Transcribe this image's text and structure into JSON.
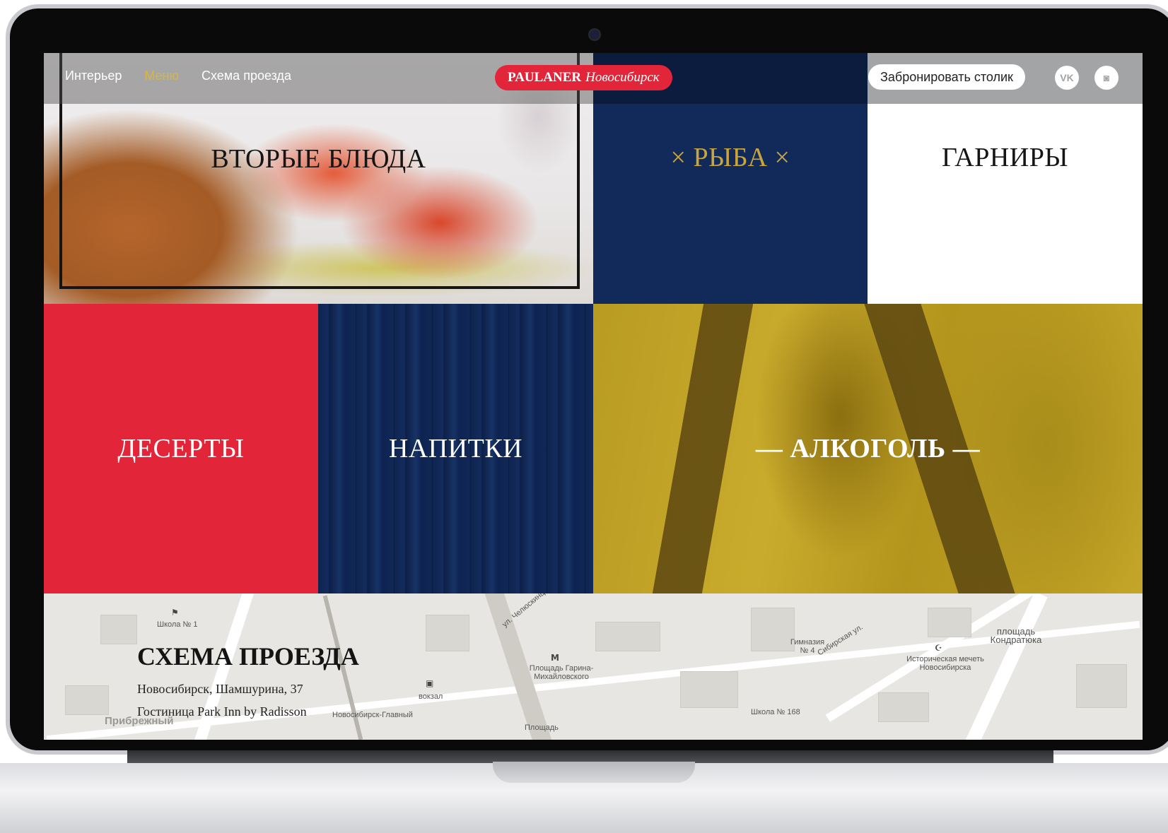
{
  "nav": {
    "items": [
      "Интерьер",
      "Меню",
      "Схема проезда"
    ],
    "active": "Меню"
  },
  "logo": {
    "brand": "PAULANER",
    "city": "Новосибирск"
  },
  "header": {
    "book_button": "Забронировать столик",
    "social": [
      {
        "icon": "vk-icon",
        "glyph": "VK"
      },
      {
        "icon": "instagram-icon",
        "glyph": "◙"
      }
    ]
  },
  "tiles": {
    "second_courses": "ВТОРЫЕ БЛЮДА",
    "fish": "× РЫБА ×",
    "garnish": "ГАРНИРЫ",
    "desserts": "ДЕСЕРТЫ",
    "drinks": "НАПИТКИ",
    "alcohol": "— АЛКОГОЛЬ —"
  },
  "map_section": {
    "title": "СХЕМА ПРОЕЗДА",
    "address_line1": "Новосибирск, Шамшурина, 37",
    "address_line2": "Гостиница Park Inn by Radisson",
    "labels": [
      "Школа № 1",
      "вокзал",
      "Новосибирск-Главный",
      "Площадь Гарина-Михайловского",
      "Гимназия № 4",
      "Школа № 168",
      "Историческая мечеть Новосибирска",
      "площадь Кондратюка",
      "Прибрежный",
      "ул. Челюскинцев",
      "Сибирская ул.",
      "Площадь"
    ]
  },
  "colors": {
    "red": "#e3253a",
    "navy": "#112a5a",
    "gold": "#c9a53b",
    "mustard": "#c4a528"
  }
}
